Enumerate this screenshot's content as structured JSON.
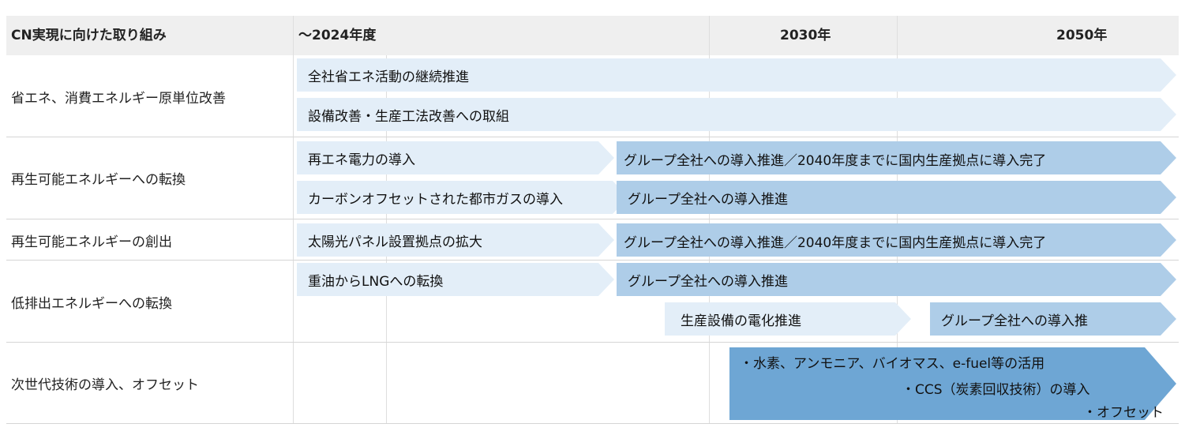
{
  "header": {
    "col_initiative": "CN実現に向けた取り組み",
    "col_2024": "～2024年度",
    "col_2030": "2030年",
    "col_2050": "2050年"
  },
  "rows": [
    {
      "label": "省エネ、消費エネルギー原単位改善",
      "bars": [
        "全社省エネ活動の継続推進",
        "設備改善・生産工法改善への取組"
      ]
    },
    {
      "label": "再生可能エネルギーへの転換",
      "bars": [
        "再エネ電力の導入",
        "グループ全社への導入推進／2040年度までに国内生産拠点に導入完了",
        "カーボンオフセットされた都市ガスの導入",
        "グループ全社への導入推進"
      ]
    },
    {
      "label": "再生可能エネルギーの創出",
      "bars": [
        "太陽光パネル設置拠点の拡大",
        "グループ全社への導入推進／2040年度までに国内生産拠点に導入完了"
      ]
    },
    {
      "label": "低排出エネルギーへの転換",
      "bars": [
        "重油からLNGへの転換",
        "グループ全社への導入推進",
        "生産設備の電化推進",
        "グループ全社への導入推"
      ]
    },
    {
      "label": "次世代技術の導入、オフセット",
      "notes": [
        "・水素、アンモニア、バイオマス、e-fuel等の活用",
        "・CCS（炭素回収技術）の導入",
        "・オフセット"
      ]
    }
  ],
  "colors": {
    "header_bg": "#efefef",
    "light_arrow": "#e3eef8",
    "mid_arrow": "#aecde8",
    "dark_arrow": "#6ea6d4"
  }
}
